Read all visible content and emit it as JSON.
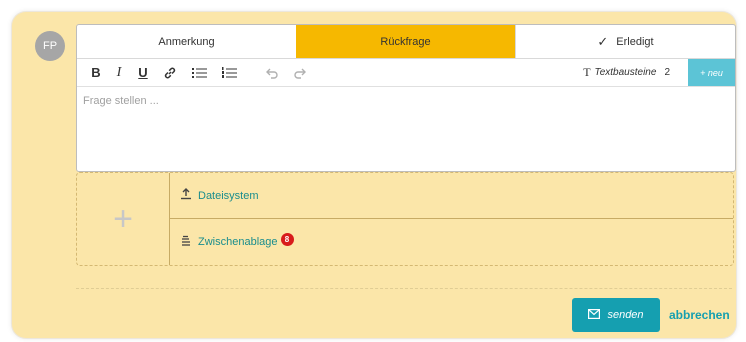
{
  "avatar": {
    "initials": "FP"
  },
  "tabs": [
    {
      "label": "Anmerkung",
      "active": false
    },
    {
      "label": "Rückfrage",
      "active": true
    },
    {
      "label": "Erledigt",
      "active": false,
      "icon": "check-icon"
    }
  ],
  "toolbar": {
    "bold": "B",
    "italic": "I",
    "underline": "U",
    "textbausteine_label": "Textbausteine",
    "textbausteine_count": "2",
    "new_label": "+ neu"
  },
  "editor": {
    "placeholder": "Frage stellen ..."
  },
  "upload": {
    "filesystem_label": "Dateisystem",
    "clipboard_label": "Zwischenablage",
    "clipboard_badge": "8"
  },
  "actions": {
    "send_label": "senden",
    "cancel_label": "abbrechen"
  },
  "colors": {
    "card_bg": "#fbe6a9",
    "active_tab": "#f6b800",
    "accent": "#159fb0",
    "badge": "#d81b1b"
  }
}
